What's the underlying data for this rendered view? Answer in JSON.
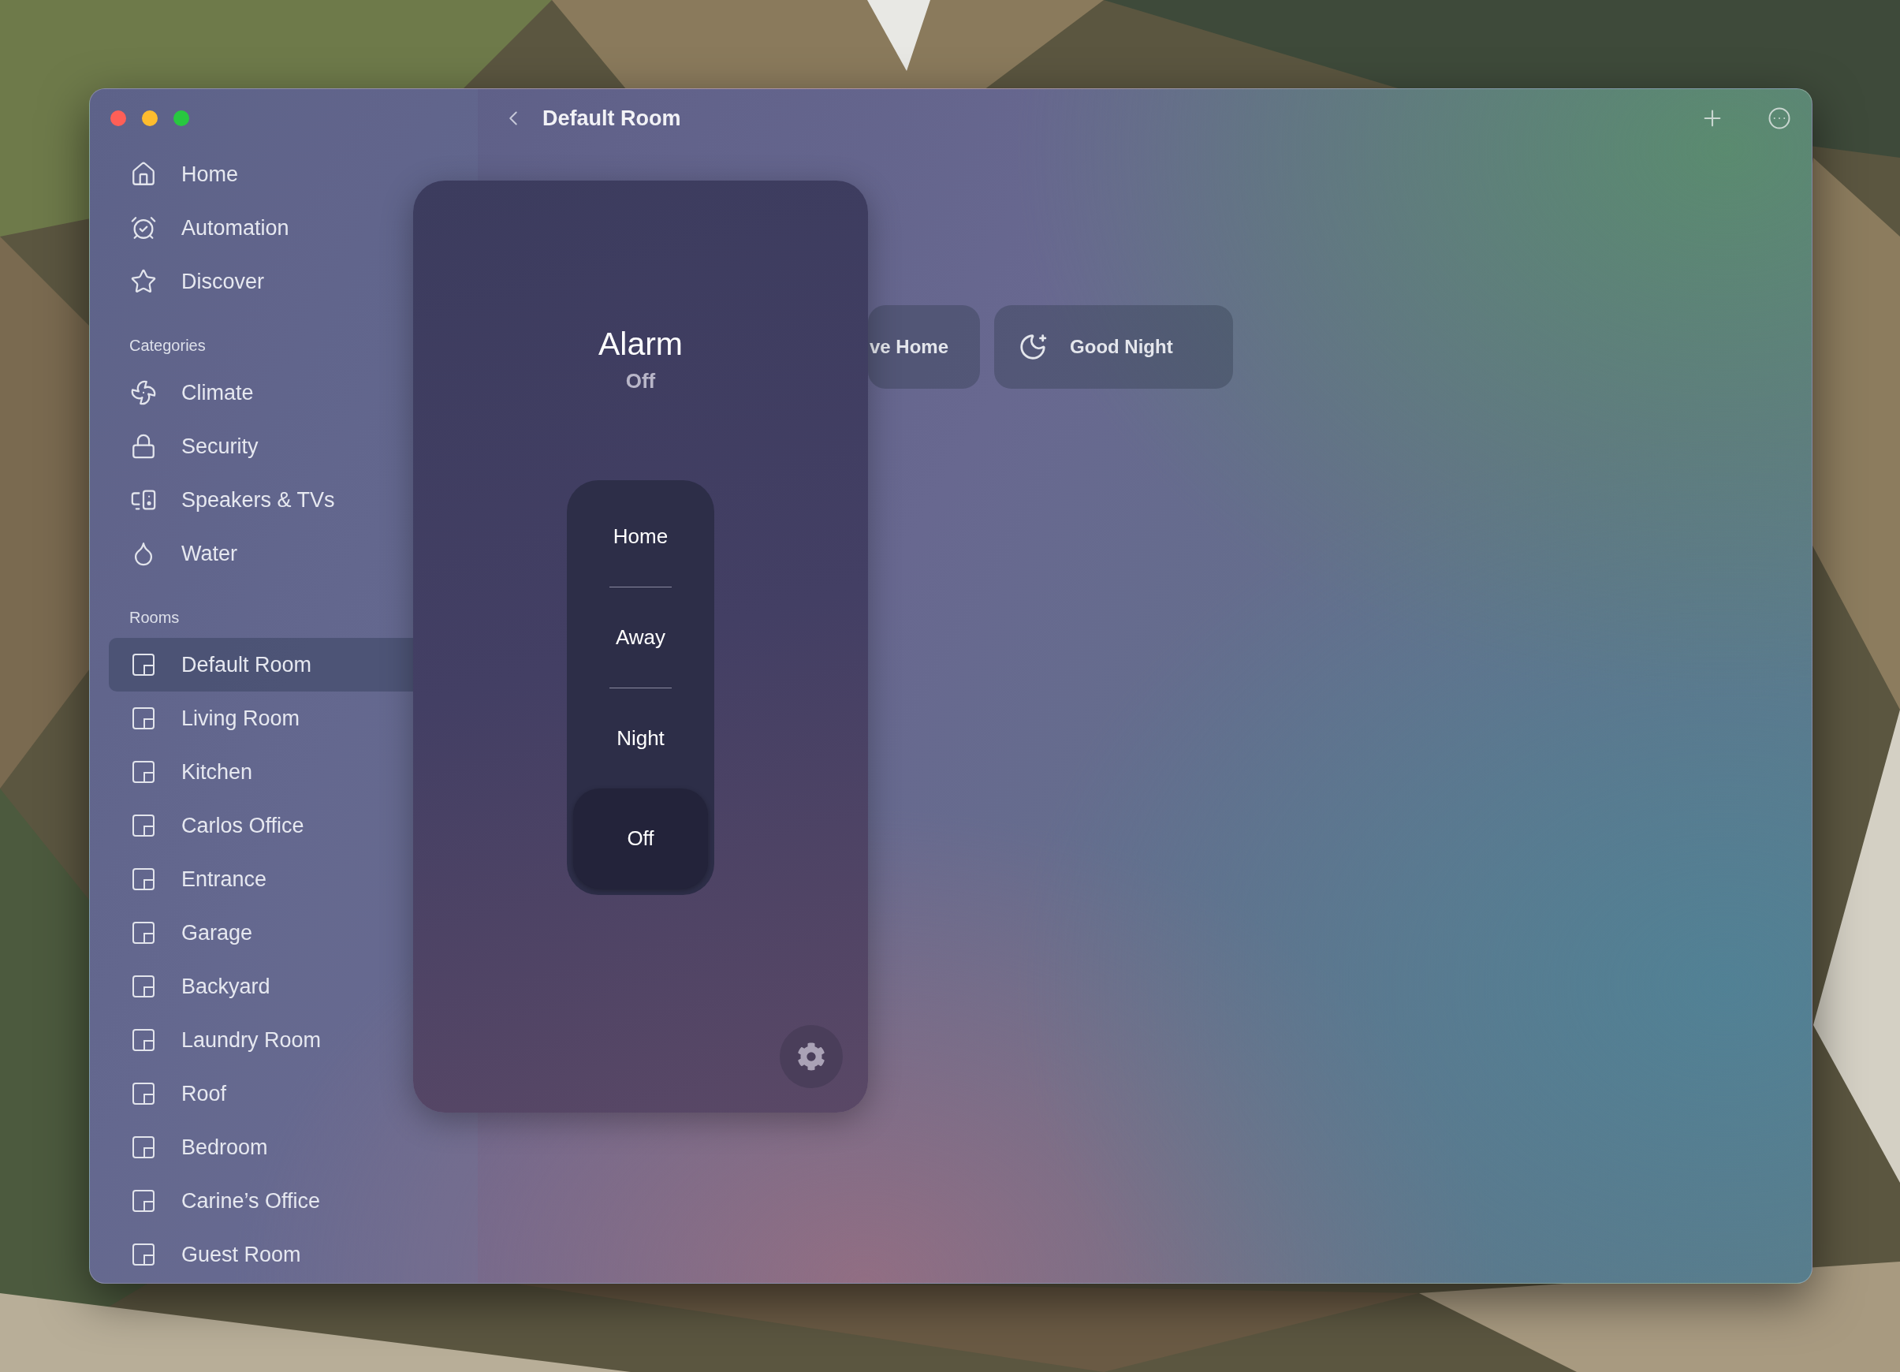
{
  "window": {
    "title": "Default Room"
  },
  "sidebar": {
    "items": [
      {
        "label": "Home",
        "selected": false
      },
      {
        "label": "Automation",
        "selected": false
      },
      {
        "label": "Discover",
        "selected": false
      }
    ],
    "sections": [
      {
        "title": "Categories",
        "items": [
          {
            "label": "Climate",
            "selected": false
          },
          {
            "label": "Security",
            "selected": false
          },
          {
            "label": "Speakers & TVs",
            "selected": false
          },
          {
            "label": "Water",
            "selected": false
          }
        ]
      },
      {
        "title": "Rooms",
        "items": [
          {
            "label": "Default Room",
            "selected": true
          },
          {
            "label": "Living Room",
            "selected": false
          },
          {
            "label": "Kitchen",
            "selected": false
          },
          {
            "label": "Carlos Office",
            "selected": false
          },
          {
            "label": "Entrance",
            "selected": false
          },
          {
            "label": "Garage",
            "selected": false
          },
          {
            "label": "Backyard",
            "selected": false
          },
          {
            "label": "Laundry Room",
            "selected": false
          },
          {
            "label": "Roof",
            "selected": false
          },
          {
            "label": "Bedroom",
            "selected": false
          },
          {
            "label": "Carine’s Office",
            "selected": false
          },
          {
            "label": "Guest Room",
            "selected": false
          }
        ]
      }
    ]
  },
  "scenes": [
    {
      "label": "ve Home"
    },
    {
      "label": "Good Night"
    }
  ],
  "alarm": {
    "title": "Alarm",
    "status": "Off",
    "modes": [
      {
        "label": "Home",
        "selected": false
      },
      {
        "label": "Away",
        "selected": false
      },
      {
        "label": "Night",
        "selected": false
      },
      {
        "label": "Off",
        "selected": true
      }
    ]
  }
}
